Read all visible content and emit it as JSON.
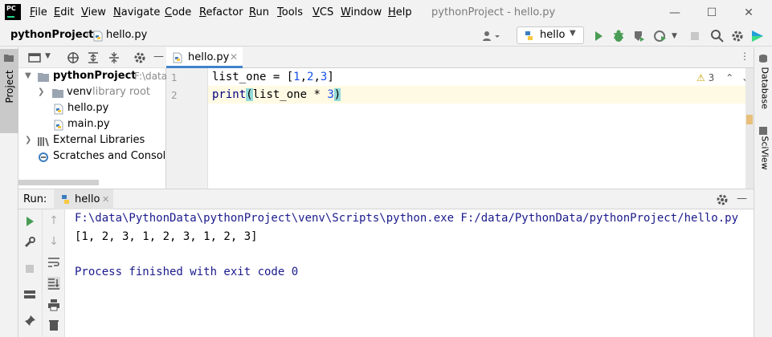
{
  "window": {
    "title": "pythonProject - hello.py",
    "app_logo": "PC"
  },
  "menu": {
    "items": [
      {
        "label": "File",
        "mnemonic_index": 0
      },
      {
        "label": "Edit",
        "mnemonic_index": 0
      },
      {
        "label": "View",
        "mnemonic_index": 0
      },
      {
        "label": "Navigate",
        "mnemonic_index": 0
      },
      {
        "label": "Code",
        "mnemonic_index": 0
      },
      {
        "label": "Refactor",
        "mnemonic_index": 0
      },
      {
        "label": "Run",
        "mnemonic_index": 0
      },
      {
        "label": "Tools",
        "mnemonic_index": 0
      },
      {
        "label": "VCS",
        "mnemonic_index": 0
      },
      {
        "label": "Window",
        "mnemonic_index": 0
      },
      {
        "label": "Help",
        "mnemonic_index": 0
      }
    ]
  },
  "navbar": {
    "project": "pythonProject",
    "separator": "›",
    "file": "hello.py",
    "run_config": "hello"
  },
  "left_stripe": {
    "project_tab": "Project"
  },
  "right_stripe": {
    "database_tab": "Database",
    "sciview_tab": "SciView"
  },
  "project_tree": {
    "root_label": "pythonProject",
    "root_path": "F:\\data\\P",
    "venv_label": "venv",
    "venv_note": "library root",
    "files": [
      "hello.py",
      "main.py"
    ],
    "external_libraries": "External Libraries",
    "scratches": "Scratches and Consoles"
  },
  "editor": {
    "tab_label": "hello.py",
    "line_numbers": [
      "1",
      "2"
    ],
    "inspection_count": "3",
    "code": {
      "line1_prefix": "list_one = [",
      "line1_n1": "1",
      "line1_c1": ",",
      "line1_n2": "2",
      "line1_c2": ",",
      "line1_n3": "3",
      "line1_suffix": "]",
      "line2_fn": "print",
      "line2_open": "(",
      "line2_mid": "list_one * ",
      "line2_num": "3",
      "line2_close": ")"
    }
  },
  "run_panel": {
    "label": "Run:",
    "tab_label": "hello",
    "console": {
      "command": "F:\\data\\PythonData\\pythonProject\\venv\\Scripts\\python.exe F:/data/PythonData/pythonProject/hello.py",
      "output": "[1, 2, 3, 1, 2, 3, 1, 2, 3]",
      "exit": "Process finished with exit code 0"
    }
  },
  "colors": {
    "accent_green": "#499c54",
    "python_blue": "#3c7ebf",
    "python_yellow": "#f7c843",
    "tab_underline": "#4083c9"
  }
}
